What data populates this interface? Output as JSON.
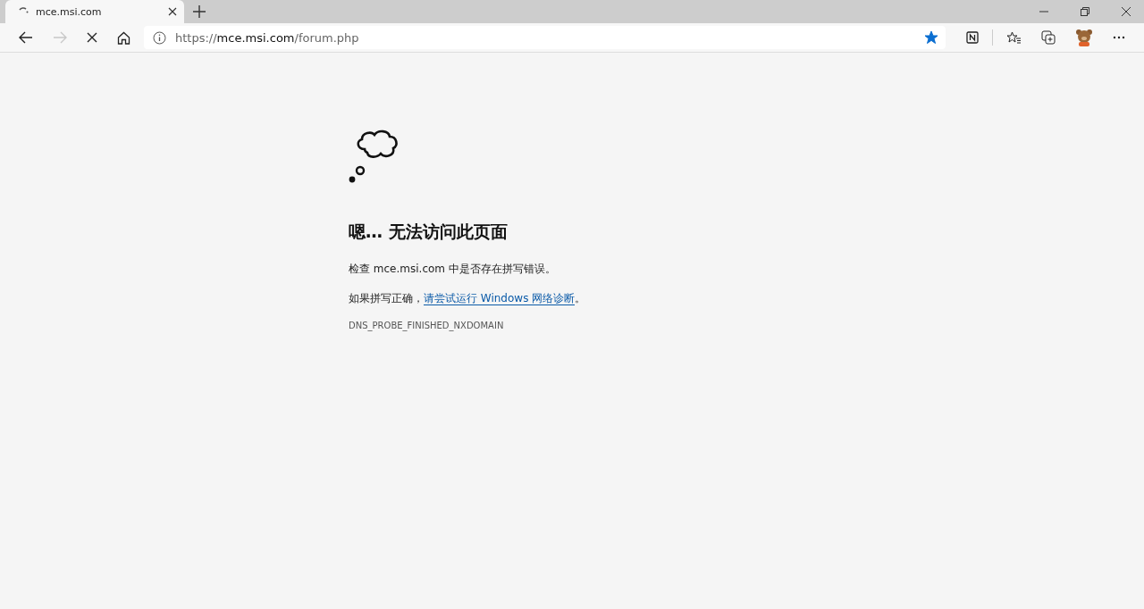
{
  "tabs": [
    {
      "title": "mce.msi.com",
      "loading": true,
      "selected": true
    }
  ],
  "toolbar": {
    "forward_disabled": true,
    "loading": true
  },
  "address": {
    "scheme": "https://",
    "host": "mce.msi.com",
    "path": "/forum.php",
    "favorited": true
  },
  "error": {
    "heading": "嗯… 无法访问此页面",
    "check_line": "检查 mce.msi.com 中是否存在拼写错误。",
    "suggest_prefix": "如果拼写正确，",
    "suggest_link": "请尝试运行 Windows 网络诊断",
    "suggest_suffix": "。",
    "code": "DNS_PROBE_FINISHED_NXDOMAIN"
  }
}
